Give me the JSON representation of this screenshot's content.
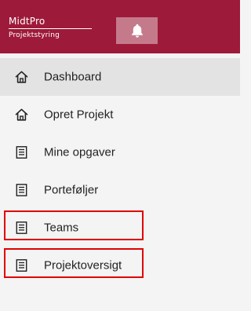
{
  "brand": {
    "name": "MidtPro",
    "subtitle": "Projektstyring"
  },
  "header": {
    "background_color": "#9e1a3a",
    "notification_icon": "bell-icon"
  },
  "menu": {
    "items": [
      {
        "label": "Dashboard",
        "icon": "home-icon",
        "active": true
      },
      {
        "label": "Opret Projekt",
        "icon": "home-icon",
        "active": false
      },
      {
        "label": "Mine opgaver",
        "icon": "document-icon",
        "active": false
      },
      {
        "label": "Porteføljer",
        "icon": "document-icon",
        "active": false
      },
      {
        "label": "Teams",
        "icon": "document-icon",
        "active": false,
        "highlighted": true
      },
      {
        "label": "Projektoversigt",
        "icon": "document-icon",
        "active": false,
        "highlighted": true
      }
    ],
    "highlight_color": "#e00000"
  }
}
